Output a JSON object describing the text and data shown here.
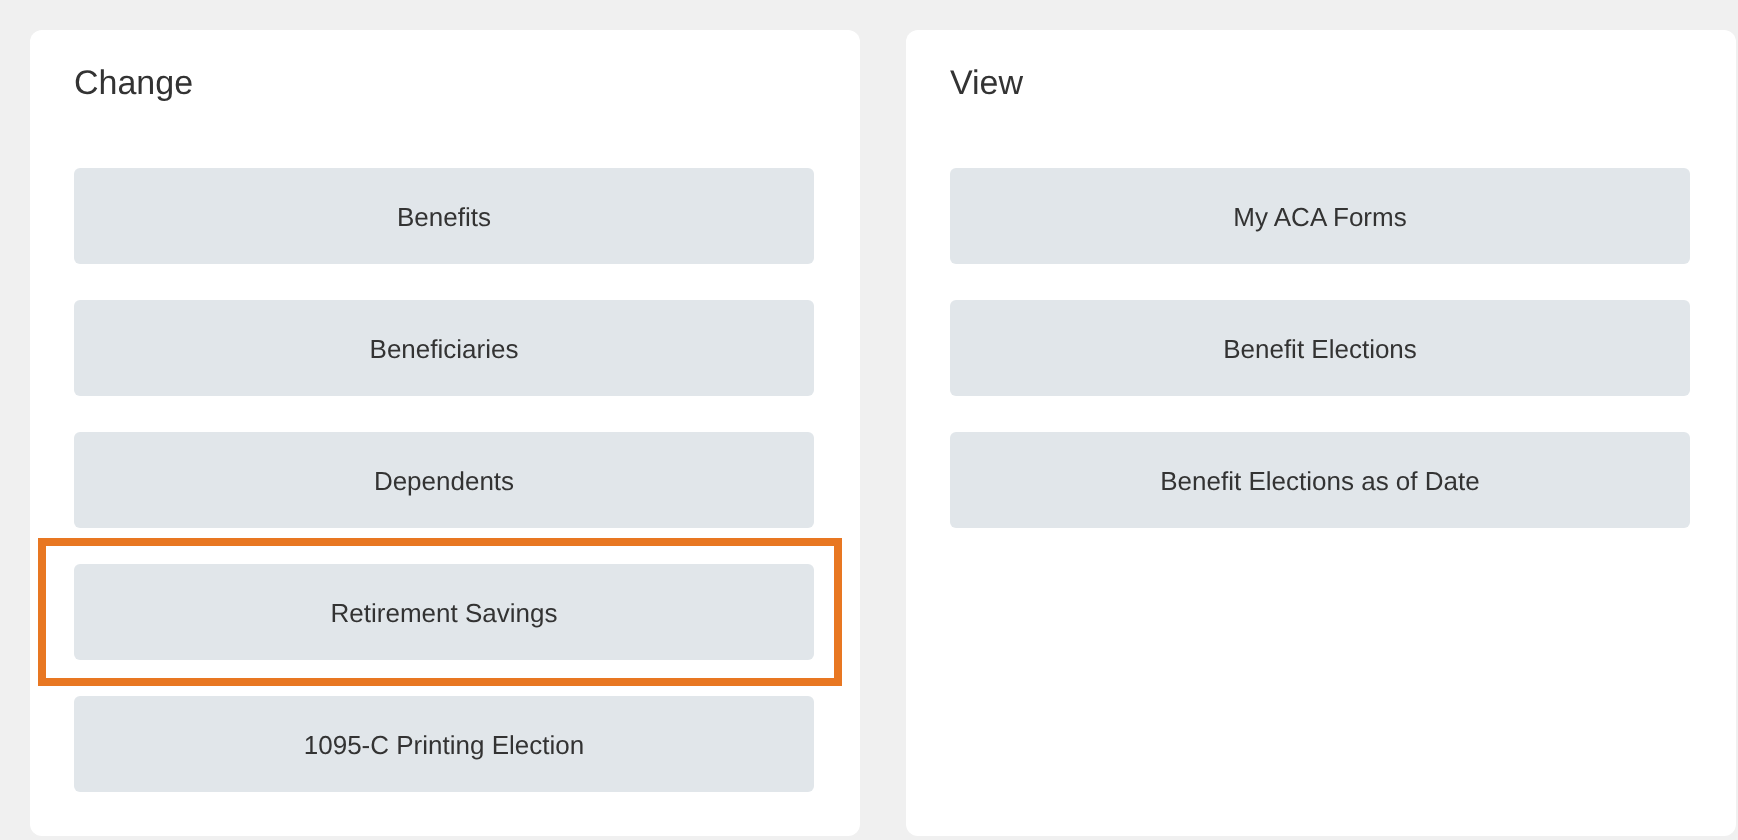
{
  "panels": [
    {
      "title": "Change",
      "buttons": [
        {
          "label": "Benefits",
          "highlighted": false
        },
        {
          "label": "Beneficiaries",
          "highlighted": false
        },
        {
          "label": "Dependents",
          "highlighted": false
        },
        {
          "label": "Retirement Savings",
          "highlighted": true
        },
        {
          "label": "1095-C Printing Election",
          "highlighted": false
        }
      ]
    },
    {
      "title": "View",
      "buttons": [
        {
          "label": "My ACA Forms",
          "highlighted": false
        },
        {
          "label": "Benefit Elections",
          "highlighted": false
        },
        {
          "label": "Benefit Elections as of Date",
          "highlighted": false
        }
      ]
    }
  ]
}
